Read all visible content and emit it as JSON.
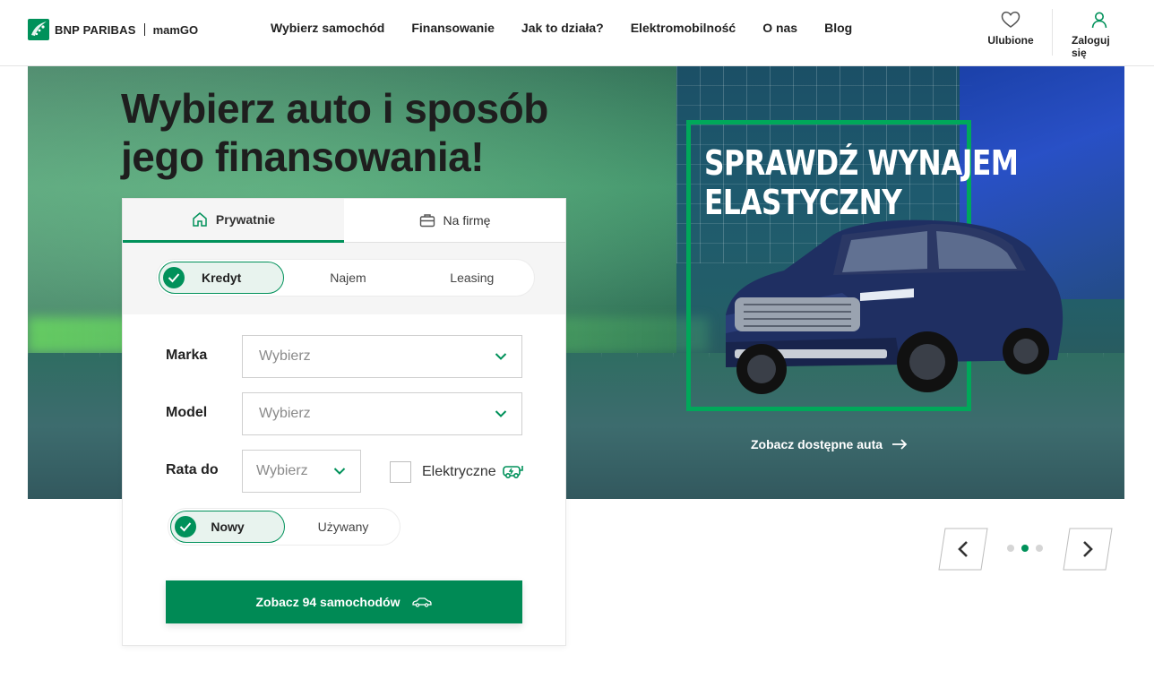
{
  "header": {
    "brand": "BNP PARIBAS",
    "sub_brand": "mamGO",
    "nav": [
      "Wybierz samochód",
      "Finansowanie",
      "Jak to działa?",
      "Elektromobilność",
      "O nas",
      "Blog"
    ],
    "favorites_label": "Ulubione",
    "login_label": "Zaloguj się"
  },
  "hero": {
    "title_line1": "Wybierz auto i sposób",
    "title_line2": "jego finansowania!",
    "promo_line1": "SPRAWDŹ WYNAJEM",
    "promo_line2": "ELASTYCZNY",
    "promo_link": "Zobacz dostępne auta"
  },
  "search": {
    "tabs": [
      "Prywatnie",
      "Na firmę"
    ],
    "active_tab": 0,
    "finance_options": [
      "Kredyt",
      "Najem",
      "Leasing"
    ],
    "active_finance": 0,
    "fields": {
      "make_label": "Marka",
      "make_value": "Wybierz",
      "model_label": "Model",
      "model_value": "Wybierz",
      "rate_label": "Rata do",
      "rate_value": "Wybierz",
      "electric_label": "Elektryczne"
    },
    "condition_options": [
      "Nowy",
      "Używany"
    ],
    "active_condition": 0,
    "cta_label": "Zobacz 94 samochodów"
  },
  "carousel": {
    "slides": 3,
    "active_slide": 1
  },
  "colors": {
    "brand_green": "#00915a",
    "cta_green": "#008a55",
    "promo_frame": "#00a85a"
  }
}
